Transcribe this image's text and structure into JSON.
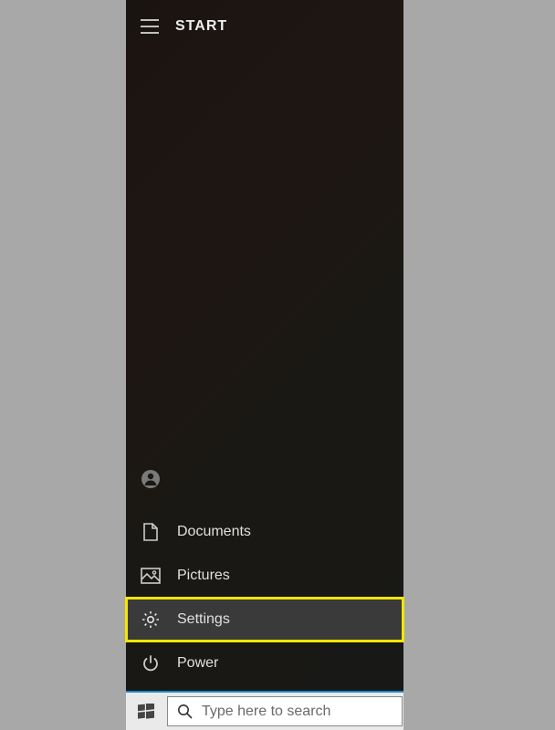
{
  "header": {
    "title": "START"
  },
  "menu": {
    "user_label": "",
    "documents_label": "Documents",
    "pictures_label": "Pictures",
    "settings_label": "Settings",
    "power_label": "Power"
  },
  "taskbar": {
    "search_placeholder": "Type here to search"
  }
}
